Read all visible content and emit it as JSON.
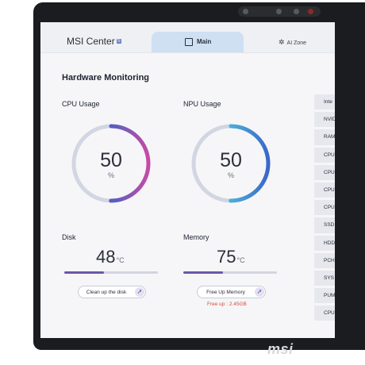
{
  "app": {
    "name": "MSI Center",
    "badge": "S"
  },
  "tabs": {
    "main": "Main",
    "ai_zone": "AI Zone"
  },
  "section_title": "Hardware Monitoring",
  "cpu": {
    "label": "CPU Usage",
    "value": "50",
    "unit": "%",
    "fraction": 0.5
  },
  "npu": {
    "label": "NPU Usage",
    "value": "50",
    "unit": "%",
    "fraction": 0.5
  },
  "disk": {
    "label": "Disk",
    "value": "48",
    "unit": "°C",
    "level": 0.42,
    "button": "Clean up the disk"
  },
  "memory": {
    "label": "Memory",
    "value": "75",
    "unit": "°C",
    "level": 0.42,
    "button": "Free Up Memory",
    "free_up": "Free up : 2.45GB"
  },
  "sidebar": {
    "items": [
      "Inte",
      "NVIDI",
      "RAM",
      "CPU",
      "CPU",
      "CPU",
      "CPU",
      "SSD",
      "HDD",
      "PCH",
      "SYS",
      "PUMP",
      "CPU"
    ]
  },
  "brand": "msi",
  "colors": {
    "cpu_gradient": [
      "#2e4fa8",
      "#5b5fc0",
      "#c64aa6"
    ],
    "npu_gradient": [
      "#3ed8d8",
      "#4aa8d8",
      "#3a68c8"
    ],
    "ring_track": "#d2d6e3",
    "free_up_text": "#d94a3e"
  }
}
